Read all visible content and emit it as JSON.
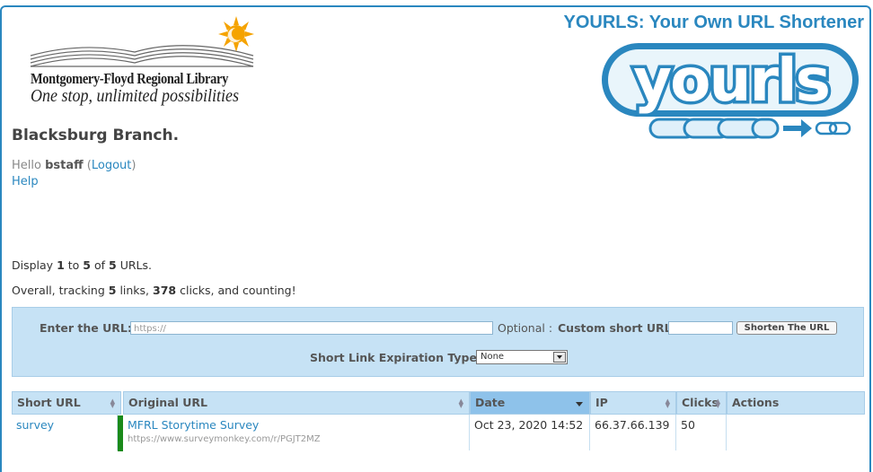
{
  "header": {
    "app_title": "YOURLS: Your Own URL Shortener",
    "logo_text": "yourls",
    "library_name": "Montgomery-Floyd Regional Library",
    "library_tagline": "One stop, unlimited possibilities"
  },
  "branch_title": "Blacksburg Branch.",
  "user": {
    "hello": "Hello",
    "username": "bstaff",
    "open_paren": "(",
    "logout_label": "Logout",
    "close_paren": ")",
    "help_label": "Help"
  },
  "summary": {
    "display_prefix": "Display",
    "from": "1",
    "to_word": "to",
    "to": "5",
    "of_word": "of",
    "total": "5",
    "suffix": "URLs.",
    "tracking_prefix": "Overall, tracking",
    "links": "5",
    "links_word": "links,",
    "clicks": "378",
    "clicks_suffix": "clicks, and counting!"
  },
  "add_form": {
    "url_label": "Enter the URL:",
    "url_placeholder": "https://",
    "optional_label": "Optional :",
    "keyword_label": "Custom short URL",
    "colon": ":",
    "shorten_label": "Shorten The URL",
    "expire_label": "Short Link Expiration Type:",
    "expire_selected": "None"
  },
  "table": {
    "columns": [
      "Short URL",
      "Original URL",
      "Date",
      "IP",
      "Clicks",
      "Actions"
    ],
    "rows": [
      {
        "short_url": "survey",
        "title": "MFRL Storytime Survey",
        "original_url": "https://www.surveymonkey.com/r/PGJT2MZ",
        "date": "Oct 23, 2020 14:52",
        "ip": "66.37.66.139",
        "clicks": "50",
        "actions": ""
      }
    ]
  },
  "colors": {
    "accent": "#2a87bf",
    "form_bg": "#c6e2f5",
    "active_header": "#8ec2ea",
    "row_marker": "#1a8a1a",
    "sun": "#f5a300"
  }
}
